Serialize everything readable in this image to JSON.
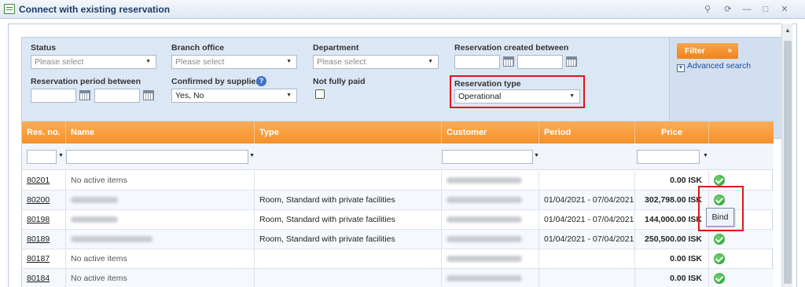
{
  "window": {
    "title": "Connect with existing reservation",
    "controls": [
      "pin-icon",
      "refresh-icon",
      "minimize-icon",
      "maximize-icon",
      "close-icon"
    ]
  },
  "filters": {
    "status": {
      "label": "Status",
      "placeholder": "Please select"
    },
    "branch_office": {
      "label": "Branch office",
      "placeholder": "Please select"
    },
    "department": {
      "label": "Department",
      "placeholder": "Please select"
    },
    "reservation_created": {
      "label": "Reservation created between"
    },
    "reservation_period": {
      "label": "Reservation period between"
    },
    "confirmed_by_suppliers": {
      "label": "Confirmed by suppliers",
      "value": "Yes, No",
      "help": "?"
    },
    "not_fully_paid": {
      "label": "Not fully paid",
      "checked": false
    },
    "reservation_type": {
      "label": "Reservation type",
      "value": "Operational"
    },
    "filter_button": "Filter",
    "filter_chevron": "»",
    "advanced_search": "Advanced search"
  },
  "grid": {
    "headers": {
      "res_no": "Res. no.",
      "name": "Name",
      "type": "Type",
      "customer": "Customer",
      "period": "Period",
      "price": "Price"
    },
    "rows": [
      {
        "res_no": "80201",
        "name": "No active items",
        "type": "",
        "period": "",
        "price": "0.00 ISK"
      },
      {
        "res_no": "80200",
        "name": "",
        "type": "Room, Standard with private facilities",
        "period": "01/04/2021 - 07/04/2021",
        "price": "302,798.00 ISK"
      },
      {
        "res_no": "80198",
        "name": "",
        "type": "Room, Standard with private facilities",
        "period": "01/04/2021 - 07/04/2021",
        "price": "144,000.00 ISK"
      },
      {
        "res_no": "80189",
        "name": "",
        "type": "Room, Standard with private facilities",
        "period": "01/04/2021 - 07/04/2021",
        "price": "250,500.00 ISK"
      },
      {
        "res_no": "80187",
        "name": "No active items",
        "type": "",
        "period": "",
        "price": "0.00 ISK"
      },
      {
        "res_no": "80184",
        "name": "No active items",
        "type": "",
        "period": "",
        "price": "0.00 ISK"
      }
    ],
    "tooltip": "Bind"
  },
  "colors": {
    "header_orange": "#f4912a",
    "filter_bg": "#dce7f5",
    "highlight_red": "#e0141e",
    "ok_green": "#1f9a2a"
  }
}
